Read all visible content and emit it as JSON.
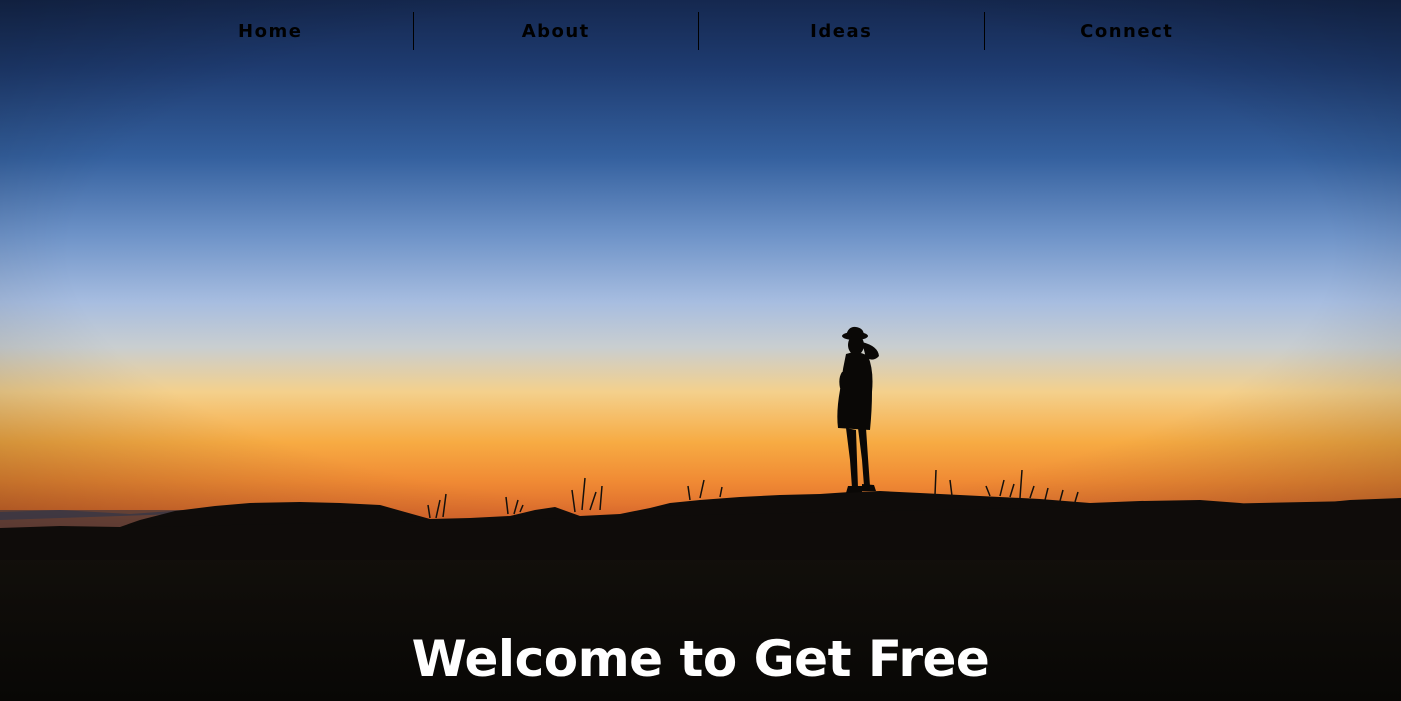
{
  "nav": {
    "items": [
      {
        "label": "Home"
      },
      {
        "label": "About"
      },
      {
        "label": "Ideas"
      },
      {
        "label": "Connect"
      }
    ]
  },
  "hero": {
    "headline": "Welcome to Get Free",
    "colors": {
      "sky_top": "#1b3260",
      "sky_mid": "#a9bfe0",
      "horizon_orange": "#f5a640",
      "ground": "#0c0a07",
      "headline_text": "#ffffff",
      "nav_text": "#000000"
    }
  }
}
